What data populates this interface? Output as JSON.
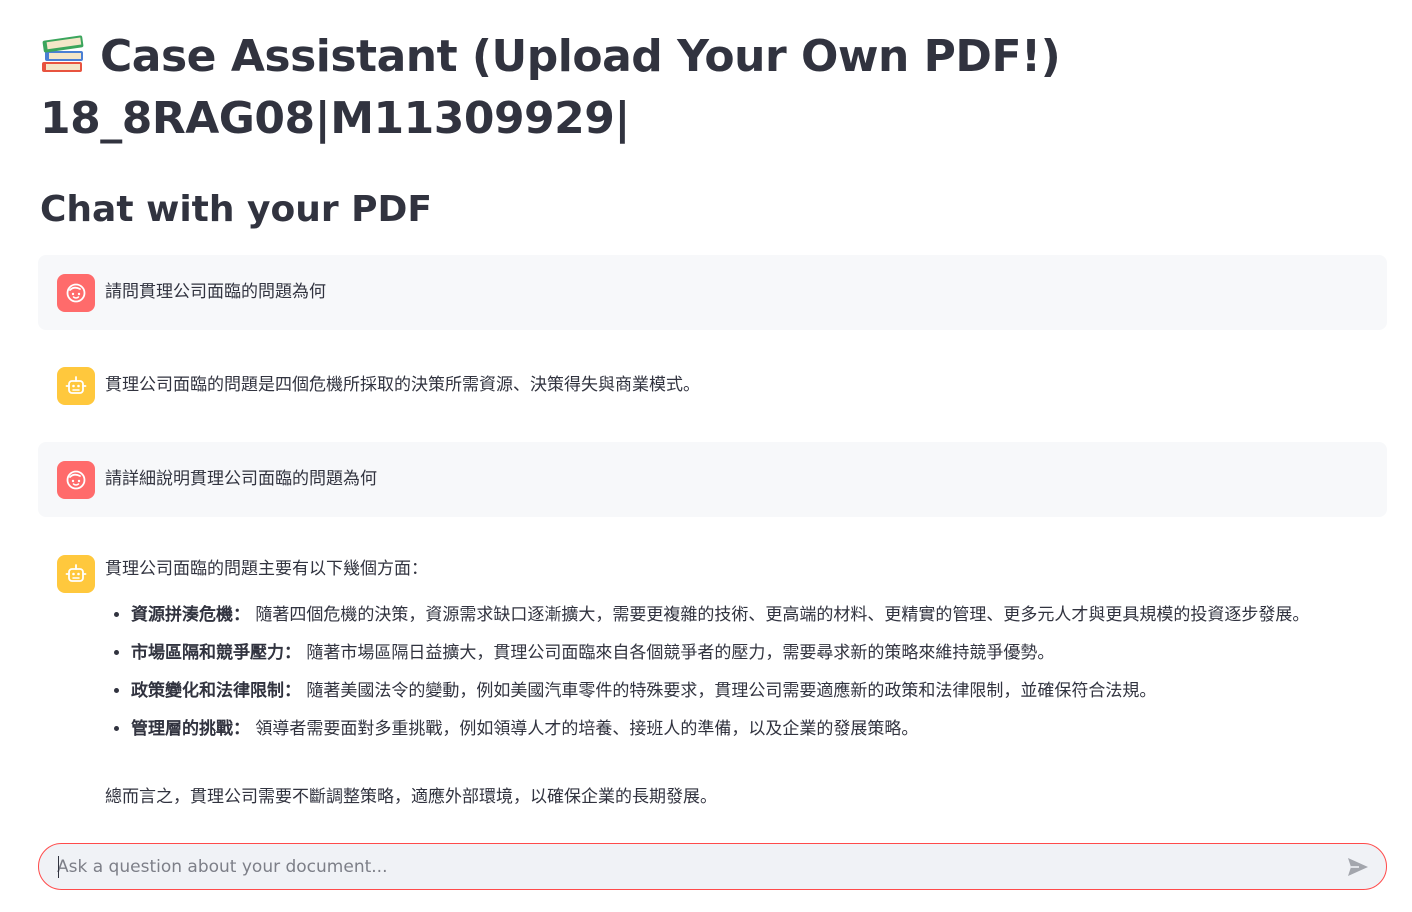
{
  "header": {
    "icon": "books-icon",
    "title_line1": "Case Assistant (Upload Your Own PDF!)",
    "title_line2": "18_8RAG08|M11309929|"
  },
  "subheader": "Chat with your PDF",
  "messages": [
    {
      "role": "user",
      "avatar_icon": "user-face-icon",
      "text": "請問貫理公司面臨的問題為何"
    },
    {
      "role": "assistant",
      "avatar_icon": "robot-icon",
      "text": "貫理公司面臨的問題是四個危機所採取的決策所需資源、決策得失與商業模式。"
    },
    {
      "role": "user",
      "avatar_icon": "user-face-icon",
      "text": "請詳細說明貫理公司面臨的問題為何"
    },
    {
      "role": "assistant",
      "avatar_icon": "robot-icon",
      "intro": "貫理公司面臨的問題主要有以下幾個方面：",
      "points": [
        {
          "title": "資源拼湊危機：",
          "text": " 隨著四個危機的決策，資源需求缺口逐漸擴大，需要更複雜的技術、更高端的材料、更精實的管理、更多元人才與更具規模的投資逐步發展。"
        },
        {
          "title": "市場區隔和競爭壓力：",
          "text": " 隨著市場區隔日益擴大，貫理公司面臨來自各個競爭者的壓力，需要尋求新的策略來維持競爭優勢。"
        },
        {
          "title": "政策變化和法律限制：",
          "text": " 隨著美國法令的變動，例如美國汽車零件的特殊要求，貫理公司需要適應新的政策和法律限制，並確保符合法規。"
        },
        {
          "title": "管理層的挑戰：",
          "text": " 領導者需要面對多重挑戰，例如領導人才的培養、接班人的準備，以及企業的發展策略。"
        }
      ],
      "summary": "總而言之，貫理公司需要不斷調整策略，適應外部環境，以確保企業的長期發展。"
    }
  ],
  "chat_input": {
    "placeholder": "Ask a question about your document...",
    "value": "",
    "send_icon": "send-icon"
  },
  "colors": {
    "user_avatar": "#ff6b6b",
    "assistant_avatar": "#ffc83d",
    "accent": "#ff4b4b",
    "text": "#31333f"
  }
}
